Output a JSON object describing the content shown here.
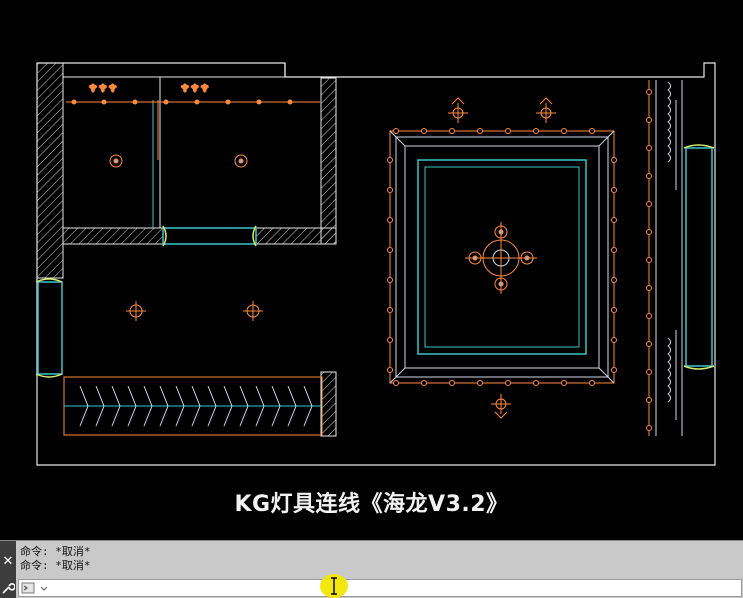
{
  "caption": "KG灯具连线《海龙V3.2》",
  "command_line": {
    "history": [
      "命令: *取消*",
      "命令: *取消*"
    ],
    "input_value": "",
    "close_icon": "close-icon",
    "settings_icon": "wrench-icon",
    "prompt_icon": "command-prompt-icon"
  },
  "colors": {
    "background": "#000000",
    "wall": "#ffffff",
    "light_fixture": "#ff8a3d",
    "ceiling_inner": "#38c6c9",
    "window_frame": "#d8e86a"
  }
}
